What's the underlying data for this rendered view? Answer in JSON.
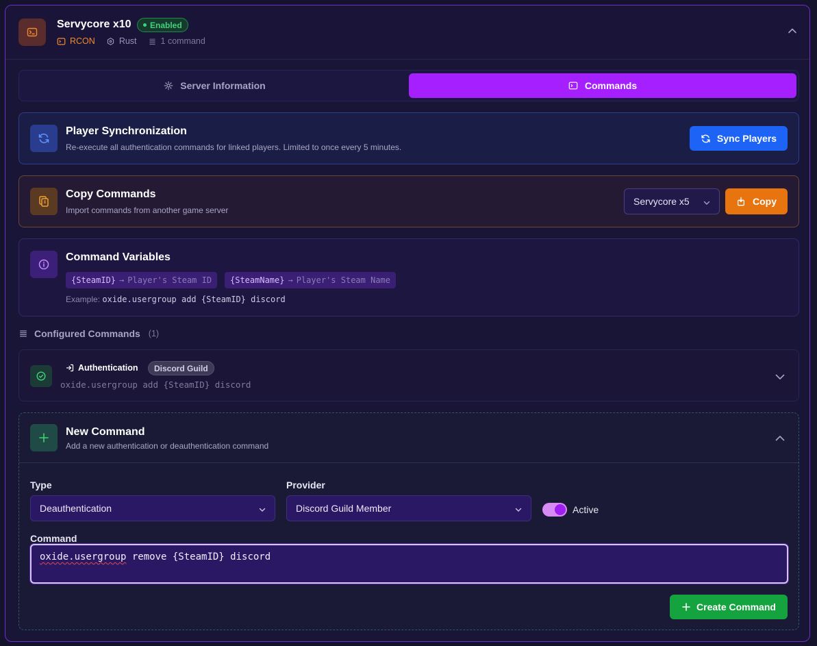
{
  "server": {
    "name": "Servycore x10",
    "status": "Enabled",
    "protocol": "RCON",
    "game": "Rust",
    "command_count": "1 command"
  },
  "tabs": [
    {
      "label": "Server Information",
      "active": false
    },
    {
      "label": "Commands",
      "active": true
    }
  ],
  "sync": {
    "title": "Player Synchronization",
    "subtitle": "Re-execute all authentication commands for linked players. Limited to once every 5 minutes.",
    "button": "Sync Players"
  },
  "copy": {
    "title": "Copy Commands",
    "subtitle": "Import commands from another game server",
    "selected_server": "Servycore x5",
    "button": "Copy"
  },
  "variables": {
    "title": "Command Variables",
    "items": [
      {
        "name": "{SteamID}",
        "arrow": "→",
        "desc": "Player's Steam ID"
      },
      {
        "name": "{SteamName}",
        "arrow": "→",
        "desc": "Player's Steam Name"
      }
    ],
    "example_label": "Example:",
    "example_code": "oxide.usergroup add {SteamID} discord"
  },
  "configured": {
    "title": "Configured Commands",
    "count": "(1)",
    "items": [
      {
        "type": "Authentication",
        "provider": "Discord Guild",
        "command": "oxide.usergroup add {SteamID} discord"
      }
    ]
  },
  "new_command": {
    "title": "New Command",
    "subtitle": "Add a new authentication or deauthentication command",
    "type_label": "Type",
    "type_value": "Deauthentication",
    "provider_label": "Provider",
    "provider_value": "Discord Guild Member",
    "active_label": "Active",
    "active": true,
    "command_label": "Command",
    "command_part1": "oxide.usergroup",
    "command_part2": " remove {SteamID} discord",
    "create_button": "Create Command"
  },
  "colors": {
    "accent": "#a51fff",
    "sync_button": "#1d63f5",
    "copy_button": "#e8740f",
    "create_button": "#14a33f",
    "enabled_badge": "#3ed37a"
  }
}
